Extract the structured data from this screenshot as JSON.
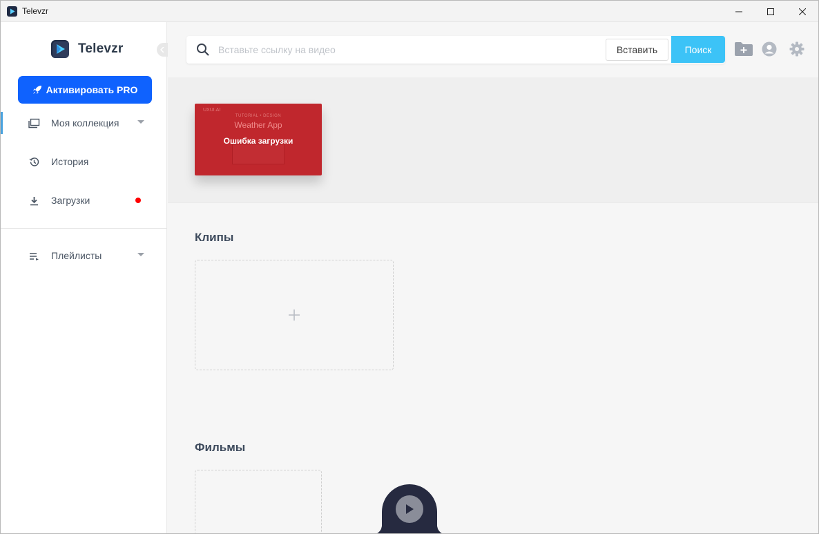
{
  "window": {
    "title": "Televzr"
  },
  "sidebar": {
    "logo_text": "Televzr",
    "pro_button": "Активировать PRO",
    "items": [
      {
        "label": "Моя коллекция",
        "icon": "collection-icon",
        "has_caret": true
      },
      {
        "label": "История",
        "icon": "history-icon"
      },
      {
        "label": "Загрузки",
        "icon": "download-icon",
        "has_badge": true
      },
      {
        "label": "Плейлисты",
        "icon": "playlist-icon",
        "has_caret": true
      }
    ]
  },
  "search": {
    "placeholder": "Вставьте ссылку на видео",
    "value": "",
    "paste_label": "Вставить",
    "search_label": "Поиск"
  },
  "video_card": {
    "tiny_left": "UXUI.AI",
    "tiny_top": "TUTORIAL • DESIGN",
    "subtitle": "Weather App",
    "error_text": "Ошибка загрузки",
    "color": "#c0272d"
  },
  "sections": {
    "clips_title": "Клипы",
    "movies_title": "Фильмы"
  },
  "colors": {
    "accent": "#0f62fe",
    "search_button": "#3cc3f7",
    "badge": "#ff0000",
    "player": "#262a40"
  }
}
